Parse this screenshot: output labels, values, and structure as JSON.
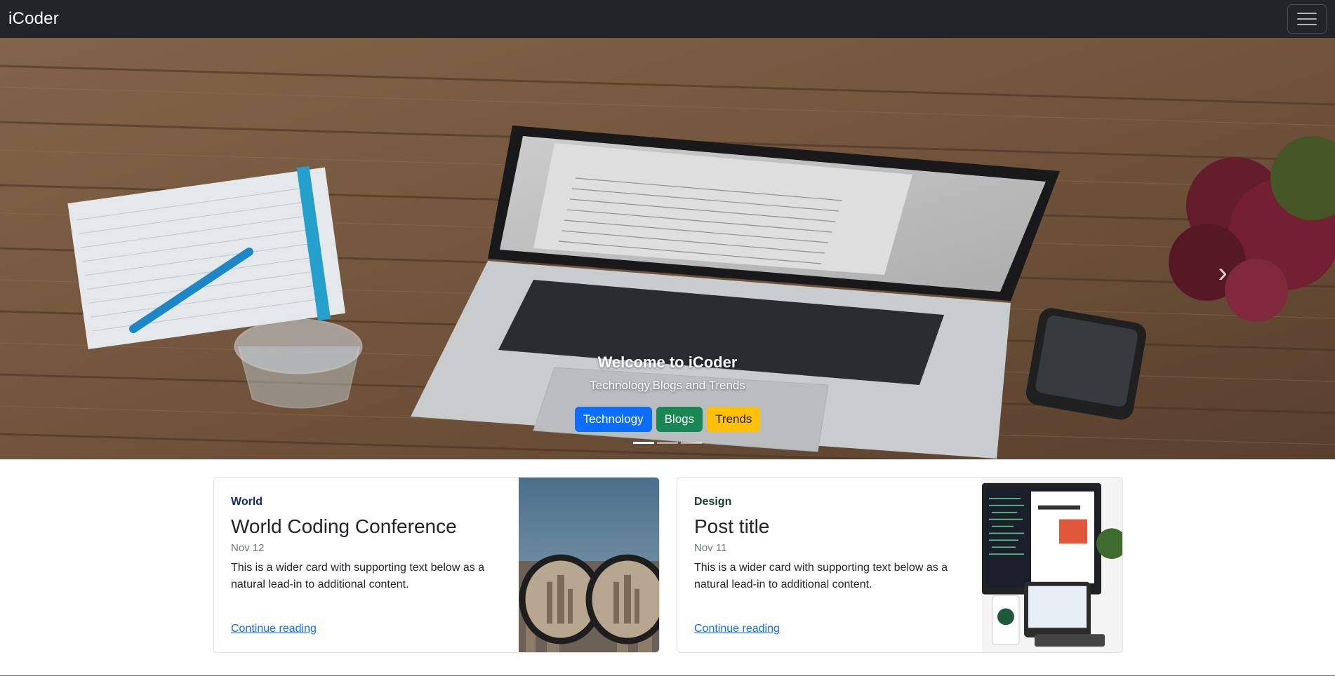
{
  "navbar": {
    "brand": "iCoder"
  },
  "hero": {
    "title": "Welcome to iCoder",
    "subtitle": "Technology,Blogs and Trends",
    "buttons": [
      "Technology",
      "Blogs",
      "Trends"
    ],
    "slide_count": 3,
    "active_slide": 1
  },
  "cards": [
    {
      "category": "World",
      "title": "World Coding Conference",
      "date": "Nov 12",
      "text": "This is a wider card with supporting text below as a natural lead-in to additional content.",
      "link": "Continue reading"
    },
    {
      "category": "Design",
      "title": "Post title",
      "date": "Nov 11",
      "text": "This is a wider card with supporting text below as a natural lead-in to additional content.",
      "link": "Continue reading"
    }
  ],
  "colors": {
    "navbar": "#212529",
    "primary": "#0d6efd",
    "success": "#198754",
    "warning": "#ffc107"
  }
}
